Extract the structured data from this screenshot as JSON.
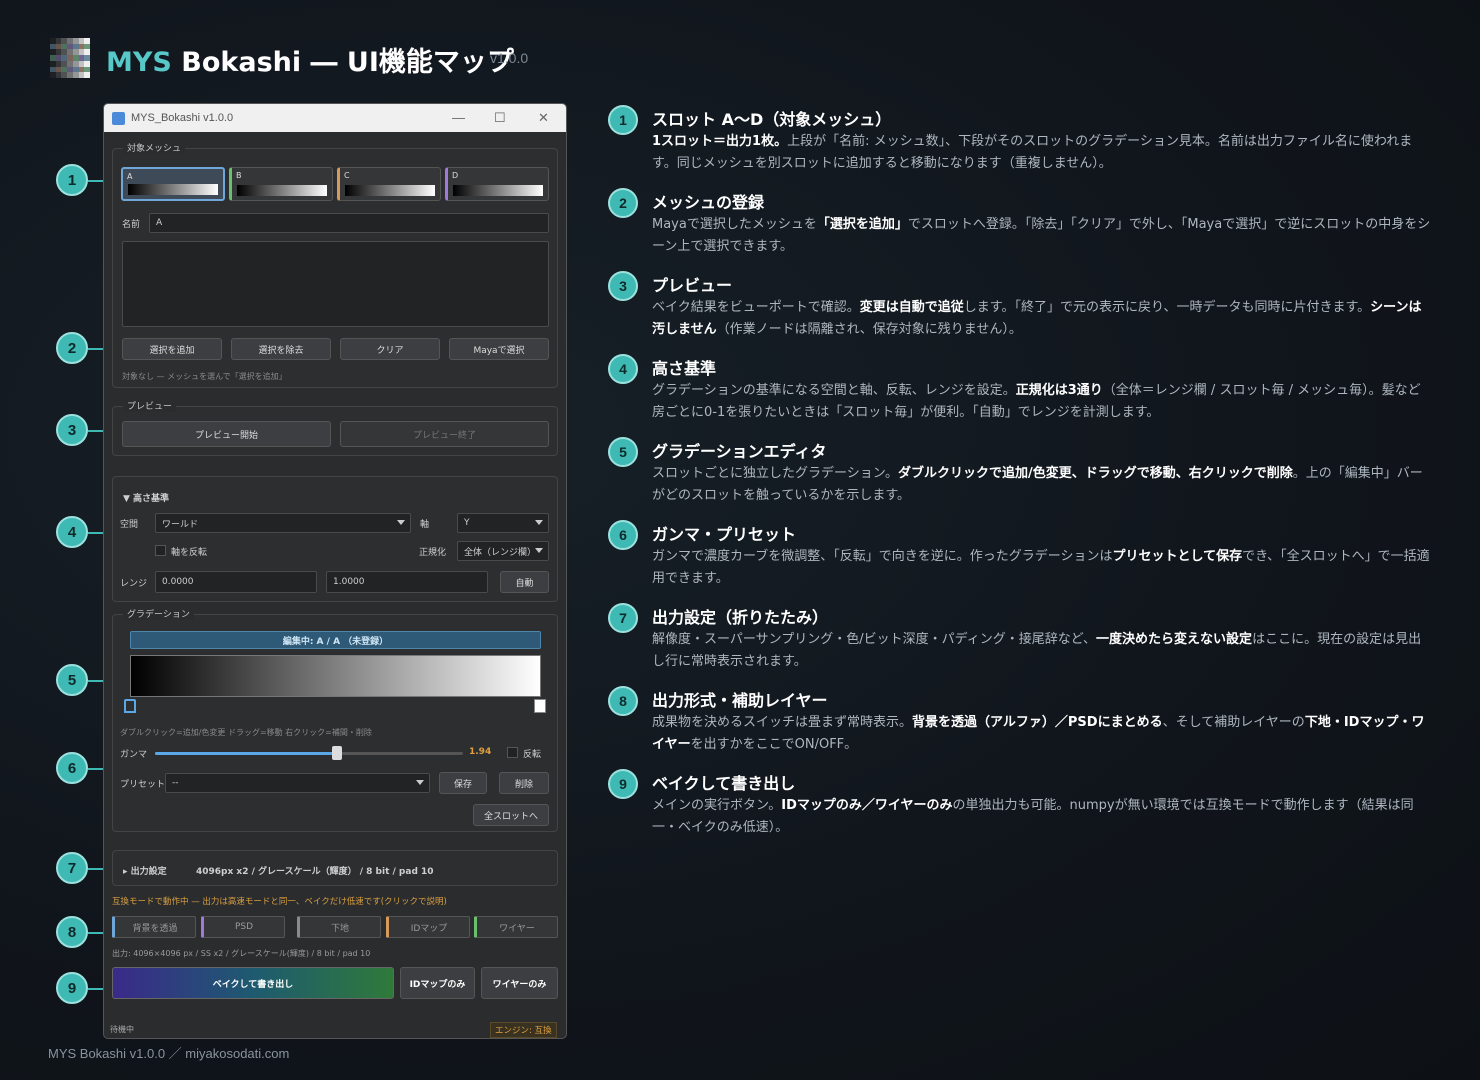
{
  "header": {
    "brand": "MYS",
    "title": " Bokashi ― UI機能マップ",
    "version": "v1.0.0"
  },
  "footer": "MYS Bokashi v1.0.0 ／ miyakosodati.com",
  "colors": {
    "accent": "#3fb9b4",
    "brand": "#58c7c7",
    "bg": "#10151b"
  },
  "window": {
    "title": "MYS_Bokashi  v1.0.0",
    "controls": [
      "—",
      "☐",
      "✕"
    ],
    "target_group": {
      "title": "対象メッシュ",
      "slots": [
        {
          "label": "A",
          "color": "#6fa8d8"
        },
        {
          "label": "B",
          "color": "#6cbf6c"
        },
        {
          "label": "C",
          "color": "#d89a5a"
        },
        {
          "label": "D",
          "color": "#a07ad8"
        }
      ],
      "name_label": "名前",
      "name_value": "A",
      "buttons": [
        "選択を追加",
        "選択を除去",
        "クリア",
        "Mayaで選択"
      ],
      "hint": "対象なし — メッシュを選んで「選択を追加」"
    },
    "preview_group": {
      "title": "プレビュー",
      "start": "プレビュー開始",
      "end": "プレビュー終了"
    },
    "height_group": {
      "title": "▼ 高さ基準",
      "space_label": "空間",
      "space_value": "ワールド",
      "axis_label": "軸",
      "axis_value": "Y",
      "invert_label": "軸を反転",
      "normalize_label": "正規化",
      "normalize_value": "全体（レンジ欄）",
      "range_label": "レンジ",
      "range_min": "0.0000",
      "range_max": "1.0000",
      "auto": "自動"
    },
    "gradient_group": {
      "title": "グラデーション",
      "editing_bar": "編集中: A / A （未登録）",
      "hint": "ダブルクリック=追加/色変更    ドラッグ=移動    右クリック=補間・削除",
      "gamma_label": "ガンマ",
      "gamma_value": "1.94",
      "gamma_fraction": 0.59,
      "invert_label": "反転",
      "preset_label": "プリセット",
      "preset_value": "--",
      "save": "保存",
      "delete": "削除",
      "apply_all": "全スロットへ"
    },
    "output_settings": {
      "title": "▸ 出力設定",
      "summary": "4096px x2 / グレースケール（輝度） / 8 bit / pad 10"
    },
    "compat_notice": "互換モードで動作中 — 出力は高速モードと同一、ベイクだけ低速です(クリックで説明)",
    "toggles": [
      {
        "label": "背景を透過",
        "color": "#6fa8d8"
      },
      {
        "label": "PSD",
        "color": "#a07ad8"
      },
      {
        "label": "下地",
        "color": "#8a8a8a"
      },
      {
        "label": "IDマップ",
        "color": "#d89a5a"
      },
      {
        "label": "ワイヤー",
        "color": "#6cbf6c"
      }
    ],
    "output_info": "出力: 4096×4096 px / SS x2 / グレースケール(輝度) / 8 bit / pad 10",
    "bake_button": "ベイクして書き出し",
    "idmap_only": "IDマップのみ",
    "wire_only": "ワイヤーのみ",
    "status": "待機中",
    "engine": "エンジン: 互換"
  },
  "sections": [
    {
      "num": "1",
      "title": "スロット A〜D（対象メッシュ）",
      "desc": [
        {
          "b": "1スロット＝出力1枚。"
        },
        {
          "t": "上段が「名前: メッシュ数」、下段がそのスロットのグラデーション見本。名前は出力ファイル名に使われます。同じメッシュを別スロットに追加すると移動になります（重複しません）。"
        }
      ]
    },
    {
      "num": "2",
      "title": "メッシュの登録",
      "desc": [
        {
          "t": "Mayaで選択したメッシュを"
        },
        {
          "b": "「選択を追加」"
        },
        {
          "t": "でスロットへ登録。「除去」「クリア」で外し、「Mayaで選択」で逆にスロットの中身をシーン上で選択できます。"
        }
      ]
    },
    {
      "num": "3",
      "title": "プレビュー",
      "desc": [
        {
          "t": "ベイク結果をビューポートで確認。"
        },
        {
          "b": "変更は自動で追従"
        },
        {
          "t": "します。「終了」で元の表示に戻り、一時データも同時に片付きます。"
        },
        {
          "b": "シーンは汚しません"
        },
        {
          "t": "（作業ノードは隔離され、保存対象に残りません）。"
        }
      ]
    },
    {
      "num": "4",
      "title": "高さ基準",
      "desc": [
        {
          "t": "グラデーションの基準になる空間と軸、反転、レンジを設定。"
        },
        {
          "b": "正規化は3通り"
        },
        {
          "t": "（全体＝レンジ欄 / スロット毎 / メッシュ毎）。髪など房ごとに0-1を張りたいときは「スロット毎」が便利。「自動」でレンジを計測します。"
        }
      ]
    },
    {
      "num": "5",
      "title": "グラデーションエディタ",
      "desc": [
        {
          "t": "スロットごとに独立したグラデーション。"
        },
        {
          "b": "ダブルクリックで追加/色変更、ドラッグで移動、右クリックで削除"
        },
        {
          "t": "。上の「編集中」バーがどのスロットを触っているかを示します。"
        }
      ]
    },
    {
      "num": "6",
      "title": "ガンマ・プリセット",
      "desc": [
        {
          "t": "ガンマで濃度カーブを微調整、「反転」で向きを逆に。作ったグラデーションは"
        },
        {
          "b": "プリセットとして保存"
        },
        {
          "t": "でき、「全スロットへ」で一括適用できます。"
        }
      ]
    },
    {
      "num": "7",
      "title": "出力設定（折りたたみ）",
      "desc": [
        {
          "t": "解像度・スーパーサンプリング・色/ビット深度・パディング・接尾辞など、"
        },
        {
          "b": "一度決めたら変えない設定"
        },
        {
          "t": "はここに。現在の設定は見出し行に常時表示されます。"
        }
      ]
    },
    {
      "num": "8",
      "title": "出力形式・補助レイヤー",
      "desc": [
        {
          "t": "成果物を決めるスイッチは畳まず常時表示。"
        },
        {
          "b": "背景を透過（アルファ）／PSDにまとめる"
        },
        {
          "t": "、そして補助レイヤーの"
        },
        {
          "b": "下地・IDマップ・ワイヤー"
        },
        {
          "t": "を出すかをここでON/OFF。"
        }
      ]
    },
    {
      "num": "9",
      "title": "ベイクして書き出し",
      "desc": [
        {
          "t": "メインの実行ボタン。"
        },
        {
          "b": "IDマップのみ／ワイヤーのみ"
        },
        {
          "t": "の単独出力も可能。numpyが無い環境では互換モードで動作します（結果は同一・ベイクのみ低速）。"
        }
      ]
    }
  ]
}
